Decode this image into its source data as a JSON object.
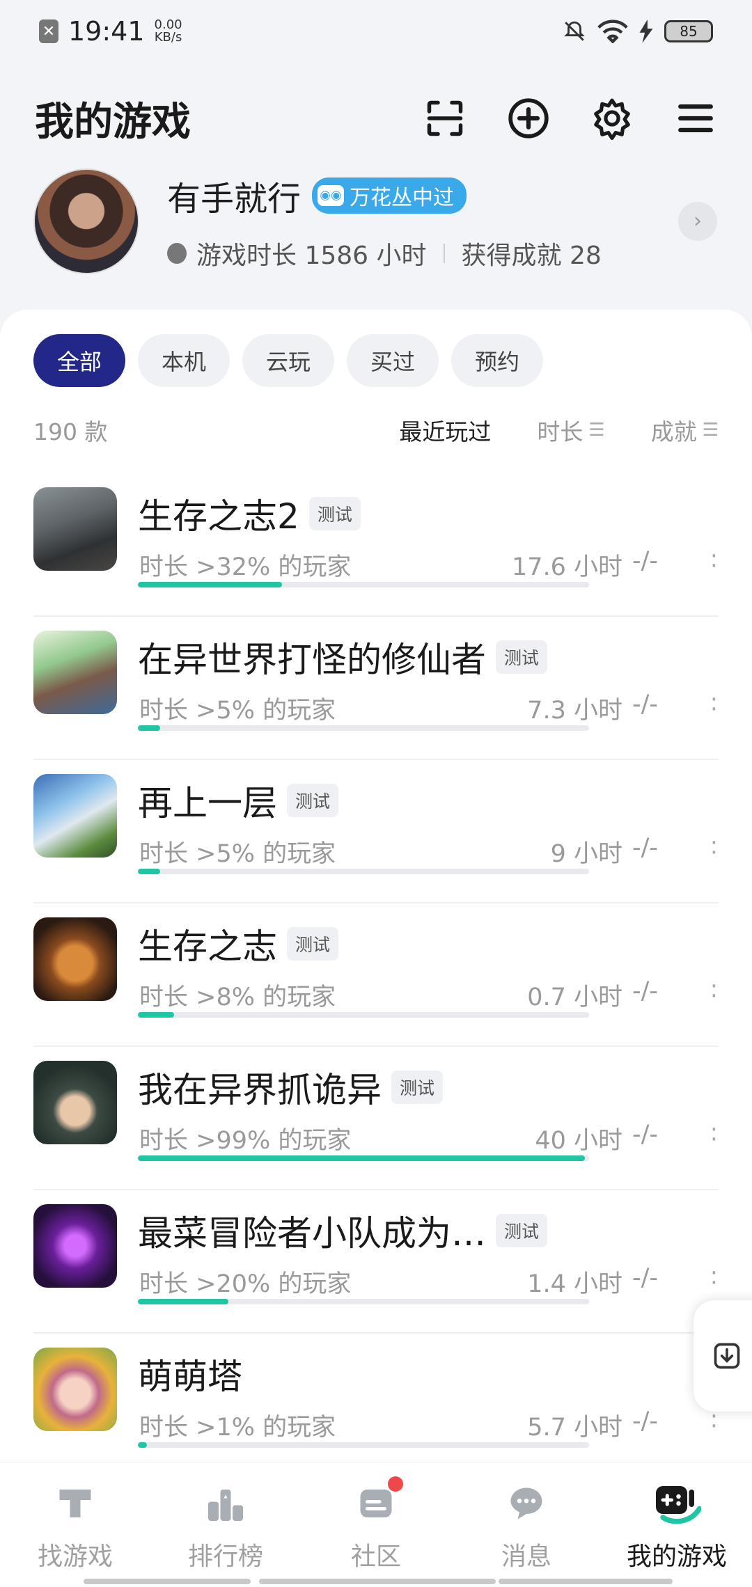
{
  "status_bar": {
    "time": "19:41",
    "speed_value": "0.00",
    "speed_unit": "KB/s",
    "battery": "85"
  },
  "header": {
    "title": "我的游戏",
    "icons": [
      "scan-icon",
      "add-circle-icon",
      "settings-icon",
      "menu-icon"
    ]
  },
  "profile": {
    "username": "有手就行",
    "badge": "万花丛中过",
    "playtime": "游戏时长 1586 小时",
    "achievements": "获得成就 28"
  },
  "filters": [
    "全部",
    "本机",
    "云玩",
    "买过",
    "预约"
  ],
  "sort": {
    "count": "190 款",
    "recent": "最近玩过",
    "duration": "时长",
    "achievement": "成就"
  },
  "games": [
    {
      "title": "生存之志2",
      "tag": "测试",
      "percentile": "时长 >32% 的玩家",
      "hours": "17.6 小时",
      "achievements": "-/-",
      "progress": 0.32
    },
    {
      "title": "在异世界打怪的修仙者",
      "tag": "测试",
      "percentile": "时长 >5% 的玩家",
      "hours": "7.3 小时",
      "achievements": "-/-",
      "progress": 0.05
    },
    {
      "title": "再上一层",
      "tag": "测试",
      "percentile": "时长 >5% 的玩家",
      "hours": "9 小时",
      "achievements": "-/-",
      "progress": 0.05
    },
    {
      "title": "生存之志",
      "tag": "测试",
      "percentile": "时长 >8% 的玩家",
      "hours": "0.7 小时",
      "achievements": "-/-",
      "progress": 0.08
    },
    {
      "title": "我在异界抓诡异",
      "tag": "测试",
      "percentile": "时长 >99% 的玩家",
      "hours": "40 小时",
      "achievements": "-/-",
      "progress": 0.99
    },
    {
      "title": "最菜冒险者小队成为…",
      "tag": "测试",
      "percentile": "时长 >20% 的玩家",
      "hours": "1.4 小时",
      "achievements": "-/-",
      "progress": 0.2
    },
    {
      "title": "萌萌塔",
      "tag": "",
      "percentile": "时长 >1% 的玩家",
      "hours": "5.7 小时",
      "achievements": "-/-",
      "progress": 0.01
    }
  ],
  "bottom_nav": [
    {
      "label": "找游戏",
      "icon": "find-game-icon"
    },
    {
      "label": "排行榜",
      "icon": "ranking-icon"
    },
    {
      "label": "社区",
      "icon": "community-icon"
    },
    {
      "label": "消息",
      "icon": "message-icon"
    },
    {
      "label": "我的游戏",
      "icon": "my-games-icon"
    }
  ],
  "colors": {
    "accent": "#232788",
    "progress": "#20c6a4",
    "badge": "#3aa9ea",
    "notification": "#f04848"
  }
}
